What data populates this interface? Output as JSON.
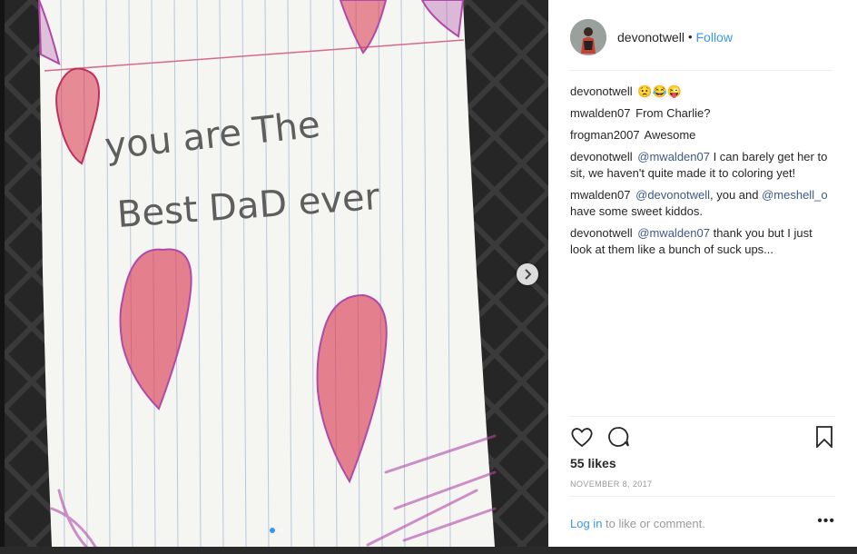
{
  "post": {
    "username": "devonotwell",
    "separator": "•",
    "follow_label": "Follow",
    "image_alt": "Handwritten note with crayon hearts",
    "handwriting_line1": "you are The",
    "handwriting_line2": "Best DaD ever"
  },
  "comments": [
    {
      "user": "devonotwell",
      "parts": [
        {
          "t": "text",
          "v": "😟😂😜"
        }
      ]
    },
    {
      "user": "mwalden07",
      "parts": [
        {
          "t": "text",
          "v": "From Charlie?"
        }
      ]
    },
    {
      "user": "frogman2007",
      "parts": [
        {
          "t": "text",
          "v": "Awesome"
        }
      ]
    },
    {
      "user": "devonotwell",
      "parts": [
        {
          "t": "mention",
          "v": "@mwalden07"
        },
        {
          "t": "text",
          "v": " I can barely get her to sit, we haven't quite made it to coloring yet!"
        }
      ]
    },
    {
      "user": "mwalden07",
      "parts": [
        {
          "t": "mention",
          "v": "@devonotwell"
        },
        {
          "t": "text",
          "v": ", you and "
        },
        {
          "t": "mention",
          "v": "@meshell_o"
        },
        {
          "t": "text",
          "v": " have some sweet kiddos."
        }
      ]
    },
    {
      "user": "devonotwell",
      "parts": [
        {
          "t": "mention",
          "v": "@mwalden07"
        },
        {
          "t": "text",
          "v": " thank you but I just look at them like a bunch of suck ups..."
        }
      ]
    }
  ],
  "stats": {
    "likes": "55 likes",
    "date": "NOVEMBER 8, 2017"
  },
  "footer": {
    "login_link": "Log in",
    "login_text": " to like or comment.",
    "more": "•••"
  },
  "icons": {
    "like": "heart-icon",
    "comment": "comment-icon",
    "save": "bookmark-icon",
    "next": "chevron-right-icon"
  },
  "colors": {
    "link_blue": "#3897f0",
    "heart_red": "#d8324a",
    "crayon_purple": "#b049a8"
  }
}
